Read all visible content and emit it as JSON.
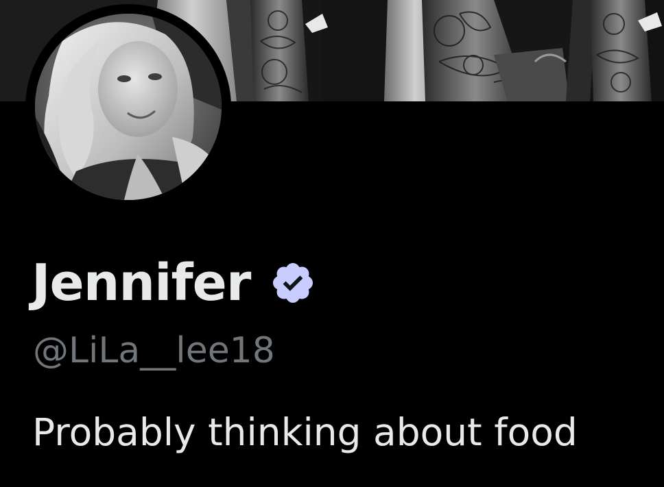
{
  "profile": {
    "display_name": "Jennifer",
    "handle": "@LiLa__lee18",
    "bio": "Probably thinking about food",
    "verified": true,
    "badge_color": "#c9ccff"
  },
  "banner": {
    "description_icon": "tattoo-banner-image"
  },
  "avatar": {
    "description_icon": "profile-photo"
  }
}
